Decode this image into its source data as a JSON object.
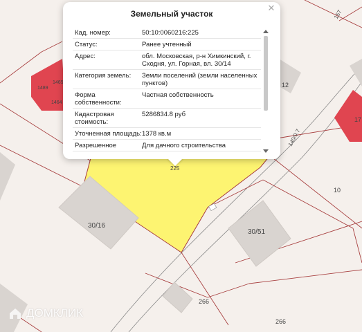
{
  "map": {
    "parcel_labels": {
      "selected": "225",
      "east": "10",
      "south_1": "266",
      "south_2": "266",
      "left_a": "1489",
      "left_b": "1465",
      "left_c": "1464",
      "right_red": "17",
      "right_top": "12",
      "corner": "157",
      "road": "140/0.7"
    },
    "building_labels": {
      "b1": "30/16",
      "b2": "30/51"
    },
    "colors": {
      "background": "#f5f0ec",
      "selected_parcel": "#fdf471",
      "building": "#d9d4d0",
      "red_building": "#e04550",
      "boundary": "#a84040"
    }
  },
  "watermark": {
    "text": "ДОМКЛИК"
  },
  "popup": {
    "title": "Земельный участок",
    "rows": [
      {
        "key": "Кад. номер:",
        "value": "50:10:0060216:225"
      },
      {
        "key": "Статус:",
        "value": "Ранее учтенный"
      },
      {
        "key": "Адрес:",
        "value": "обл. Московская, р-н Химкинский, г. Сходня, ул. Горная, вл. 30/14"
      },
      {
        "key": "Категория земель:",
        "value": "Земли поселений (земли населенных пунктов)"
      },
      {
        "key": "Форма собственности:",
        "value": "Частная собственность"
      },
      {
        "key": "Кадастровая стоимость:",
        "value": "5286834.8 руб"
      },
      {
        "key": "Уточненная площадь:",
        "value": "1378 кв.м"
      },
      {
        "key": "Разрешенное",
        "value": "Для дачного строительства"
      }
    ]
  }
}
